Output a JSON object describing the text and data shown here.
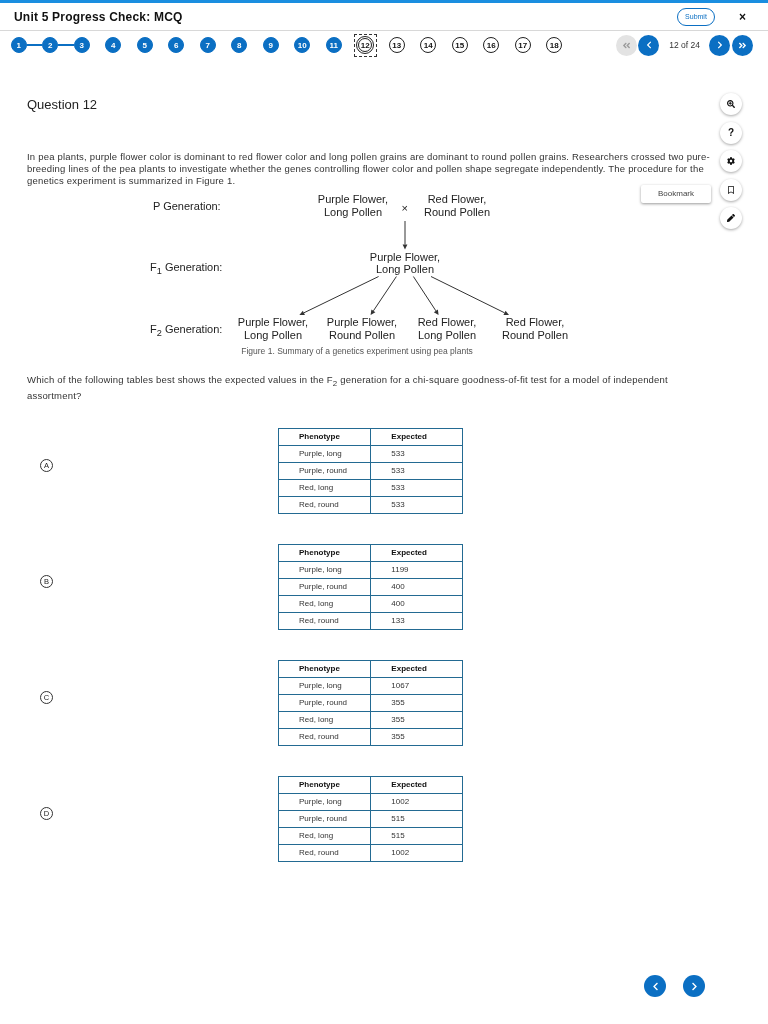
{
  "header": {
    "title": "Unit 5 Progress Check: MCQ",
    "submit_label": "Submit",
    "close_label": "×"
  },
  "question_nav": {
    "items": [
      {
        "label": "1",
        "answered": true,
        "selected": false,
        "joined_to_next": true
      },
      {
        "label": "2",
        "answered": true,
        "selected": false,
        "joined_to_next": true
      },
      {
        "label": "3",
        "answered": true,
        "selected": false,
        "joined_to_next": false
      },
      {
        "label": "4",
        "answered": true,
        "selected": false,
        "joined_to_next": false
      },
      {
        "label": "5",
        "answered": true,
        "selected": false,
        "joined_to_next": false
      },
      {
        "label": "6",
        "answered": true,
        "selected": false,
        "joined_to_next": false
      },
      {
        "label": "7",
        "answered": true,
        "selected": false,
        "joined_to_next": false
      },
      {
        "label": "8",
        "answered": true,
        "selected": false,
        "joined_to_next": false
      },
      {
        "label": "9",
        "answered": true,
        "selected": false,
        "joined_to_next": false
      },
      {
        "label": "10",
        "answered": true,
        "selected": false,
        "joined_to_next": false
      },
      {
        "label": "11",
        "answered": true,
        "selected": false,
        "joined_to_next": false
      },
      {
        "label": "12",
        "answered": false,
        "selected": true,
        "joined_to_next": false
      },
      {
        "label": "13",
        "answered": false,
        "selected": false,
        "joined_to_next": false
      },
      {
        "label": "14",
        "answered": false,
        "selected": false,
        "joined_to_next": false
      },
      {
        "label": "15",
        "answered": false,
        "selected": false,
        "joined_to_next": false
      },
      {
        "label": "16",
        "answered": false,
        "selected": false,
        "joined_to_next": false
      },
      {
        "label": "17",
        "answered": false,
        "selected": false,
        "joined_to_next": false
      },
      {
        "label": "18",
        "answered": false,
        "selected": false,
        "joined_to_next": false
      }
    ],
    "pager": [
      {
        "kind": "first",
        "disabled": true
      },
      {
        "kind": "previous",
        "disabled": false
      },
      {
        "kind": "position",
        "text": "12 of 24"
      },
      {
        "kind": "next",
        "disabled": false
      },
      {
        "kind": "last",
        "disabled": false
      }
    ]
  },
  "question": {
    "title": "Question 12",
    "stem": "In pea plants, purple flower color is dominant to red flower color and long pollen grains are dominant to round pollen grains. Researchers crossed two pure-breeding lines of the pea plants to investigate whether the genes controlling flower color and pollen shape segregate independently. The procedure for the genetics experiment is summarized in Figure 1.",
    "figure": {
      "generations": [
        {
          "label": "P Generation:",
          "nodes": [
            "Purple Flower, Long Pollen",
            "Red Flower, Round Pollen"
          ],
          "cross": "×"
        },
        {
          "label": "F$_{1}$ Generation:",
          "nodes": [
            "Purple Flower, Long Pollen"
          ]
        },
        {
          "label": "F$_{2}$ Generation:",
          "nodes": [
            "Purple Flower, Long Pollen",
            "Purple Flower, Round Pollen",
            "Red Flower, Long Pollen",
            "Red Flower, Round Pollen"
          ]
        }
      ],
      "caption": "Figure 1. Summary of a genetics experiment using pea plants"
    },
    "prompt": "Which of the following tables best shows the expected values in the F$_{2}$ generation for a chi-square goodness-of-fit test for a model of independent assortment?",
    "options": [
      {
        "letter": "A",
        "table": {
          "columns": [
            "Phenotype",
            "Expected"
          ],
          "rows": [
            [
              "Purple, long",
              "533"
            ],
            [
              "Purple, round",
              "533"
            ],
            [
              "Red, long",
              "533"
            ],
            [
              "Red, round",
              "533"
            ]
          ]
        }
      },
      {
        "letter": "B",
        "table": {
          "columns": [
            "Phenotype",
            "Expected"
          ],
          "rows": [
            [
              "Purple, long",
              "1199"
            ],
            [
              "Purple, round",
              "400"
            ],
            [
              "Red, long",
              "400"
            ],
            [
              "Red, round",
              "133"
            ]
          ]
        }
      },
      {
        "letter": "C",
        "table": {
          "columns": [
            "Phenotype",
            "Expected"
          ],
          "rows": [
            [
              "Purple, long",
              "1067"
            ],
            [
              "Purple, round",
              "355"
            ],
            [
              "Red, long",
              "355"
            ],
            [
              "Red, round",
              "355"
            ]
          ]
        }
      },
      {
        "letter": "D",
        "table": {
          "columns": [
            "Phenotype",
            "Expected"
          ],
          "rows": [
            [
              "Purple, long",
              "1002"
            ],
            [
              "Purple, round",
              "515"
            ],
            [
              "Red, long",
              "515"
            ],
            [
              "Red, round",
              "1002"
            ]
          ]
        }
      }
    ]
  },
  "tools": [
    {
      "kind": "zoom"
    },
    {
      "kind": "help",
      "glyph": "?"
    },
    {
      "kind": "settings"
    },
    {
      "kind": "bookmark",
      "tooltip": "Bookmark"
    },
    {
      "kind": "annotate"
    }
  ],
  "footer_nav": [
    {
      "kind": "previous"
    },
    {
      "kind": "next"
    }
  ]
}
